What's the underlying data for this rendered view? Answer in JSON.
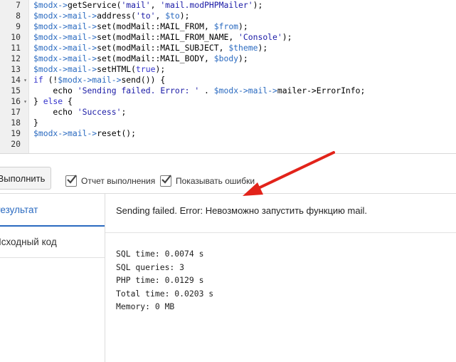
{
  "editor": {
    "lines": [
      {
        "n": "7",
        "fold": "",
        "parts": [
          [
            "v",
            "$modx->"
          ],
          [
            "t",
            "getService("
          ],
          [
            "s",
            "'mail'"
          ],
          [
            "t",
            ", "
          ],
          [
            "s",
            "'mail.modPHPMailer'"
          ],
          [
            "t",
            ");"
          ]
        ]
      },
      {
        "n": "8",
        "fold": "",
        "parts": [
          [
            "v",
            "$modx->mail->"
          ],
          [
            "t",
            "address("
          ],
          [
            "s",
            "'to'"
          ],
          [
            "t",
            ", "
          ],
          [
            "v",
            "$to"
          ],
          [
            "t",
            ");"
          ]
        ]
      },
      {
        "n": "9",
        "fold": "",
        "parts": [
          [
            "v",
            "$modx->mail->"
          ],
          [
            "t",
            "set(modMail::MAIL_FROM, "
          ],
          [
            "v",
            "$from"
          ],
          [
            "t",
            ");"
          ]
        ]
      },
      {
        "n": "10",
        "fold": "",
        "parts": [
          [
            "v",
            "$modx->mail->"
          ],
          [
            "t",
            "set(modMail::MAIL_FROM_NAME, "
          ],
          [
            "s",
            "'Console'"
          ],
          [
            "t",
            ");"
          ]
        ]
      },
      {
        "n": "11",
        "fold": "",
        "parts": [
          [
            "v",
            "$modx->mail->"
          ],
          [
            "t",
            "set(modMail::MAIL_SUBJECT, "
          ],
          [
            "v",
            "$theme"
          ],
          [
            "t",
            ");"
          ]
        ]
      },
      {
        "n": "12",
        "fold": "",
        "parts": [
          [
            "v",
            "$modx->mail->"
          ],
          [
            "t",
            "set(modMail::MAIL_BODY, "
          ],
          [
            "v",
            "$body"
          ],
          [
            "t",
            ");"
          ]
        ]
      },
      {
        "n": "13",
        "fold": "",
        "parts": [
          [
            "v",
            "$modx->mail->"
          ],
          [
            "t",
            "setHTML("
          ],
          [
            "k",
            "true"
          ],
          [
            "t",
            ");"
          ]
        ]
      },
      {
        "n": "14",
        "fold": "▾",
        "parts": [
          [
            "k",
            "if"
          ],
          [
            "t",
            " (!"
          ],
          [
            "v",
            "$modx->mail->"
          ],
          [
            "t",
            "send()) {"
          ]
        ]
      },
      {
        "n": "15",
        "fold": "",
        "parts": [
          [
            "t",
            "    echo "
          ],
          [
            "s",
            "'Sending failed. Error: '"
          ],
          [
            "t",
            " . "
          ],
          [
            "v",
            "$modx->mail->"
          ],
          [
            "t",
            "mailer->ErrorInfo;"
          ]
        ]
      },
      {
        "n": "16",
        "fold": "▾",
        "parts": [
          [
            "t",
            "} "
          ],
          [
            "k",
            "else"
          ],
          [
            "t",
            " {"
          ]
        ]
      },
      {
        "n": "17",
        "fold": "",
        "parts": [
          [
            "t",
            "    echo "
          ],
          [
            "s",
            "'Success'"
          ],
          [
            "t",
            ";"
          ]
        ]
      },
      {
        "n": "18",
        "fold": "",
        "parts": [
          [
            "t",
            "}"
          ]
        ]
      },
      {
        "n": "19",
        "fold": "",
        "parts": [
          [
            "v",
            "$modx->mail->"
          ],
          [
            "t",
            "reset();"
          ]
        ]
      },
      {
        "n": "20",
        "fold": "",
        "parts": []
      }
    ]
  },
  "toolbar": {
    "run_label": "Выполнить",
    "report_label": "Отчет выполнения",
    "errors_label": "Показывать ошибки"
  },
  "tabs": {
    "result": "Результат",
    "source": "Исходный код"
  },
  "result": {
    "message": "Sending failed. Error: Невозможно запустить функцию mail.",
    "stats": [
      "SQL time: 0.0074 s",
      "SQL queries: 3",
      "PHP time: 0.0129 s",
      "Total time: 0.0203 s",
      "Memory: 0 MB"
    ]
  },
  "colors": {
    "accent": "#2a6ac0",
    "annotation_arrow": "#e2231a"
  }
}
